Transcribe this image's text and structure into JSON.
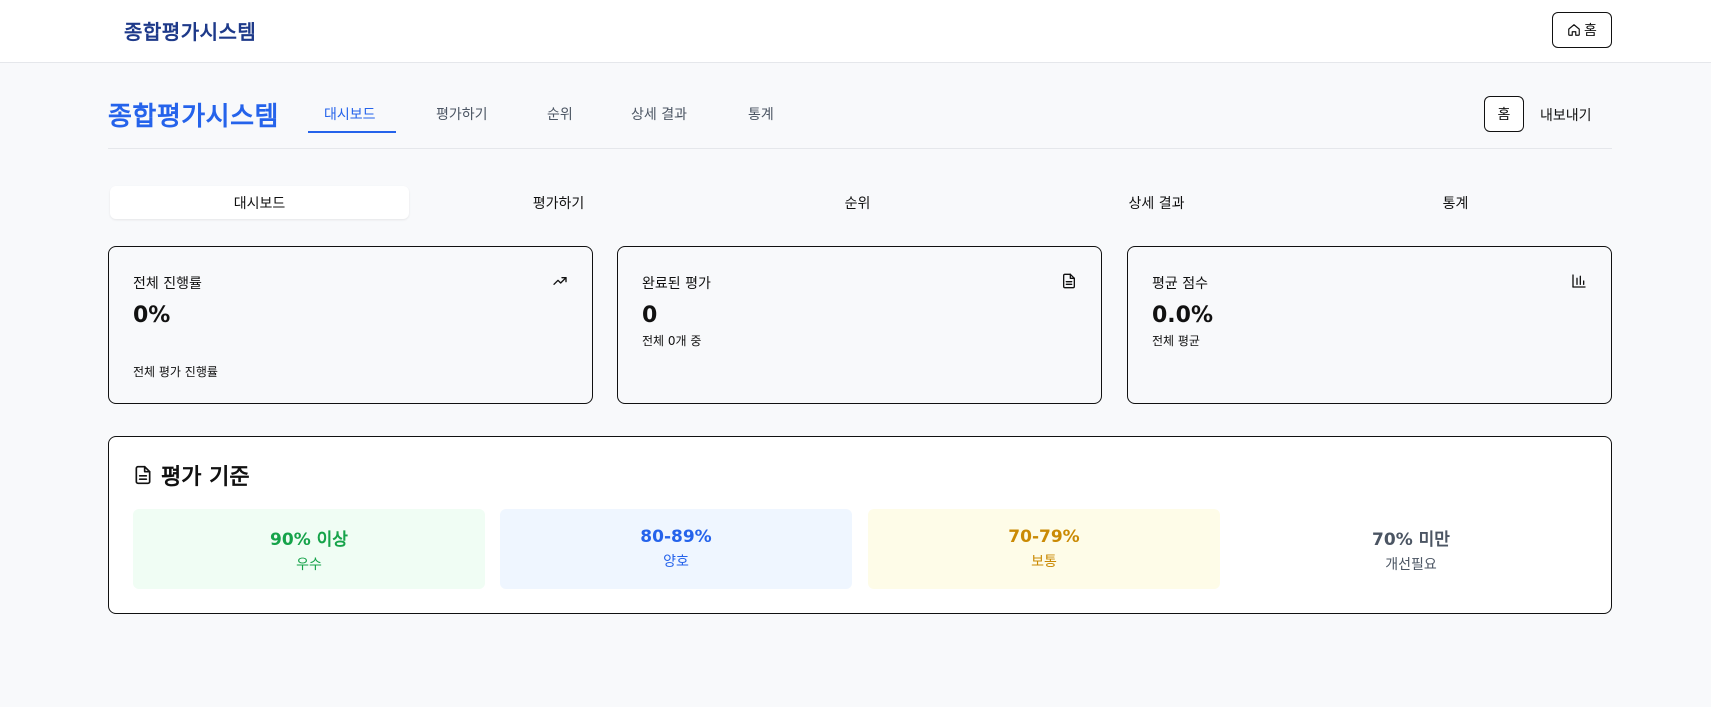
{
  "topbar": {
    "title": "종합평가시스템",
    "home_label": "홈"
  },
  "header": {
    "title": "종합평가시스템",
    "tabs": [
      {
        "label": "대시보드",
        "active": true
      },
      {
        "label": "평가하기",
        "active": false
      },
      {
        "label": "순위",
        "active": false
      },
      {
        "label": "상세 결과",
        "active": false
      },
      {
        "label": "통계",
        "active": false
      }
    ],
    "home_label": "홈",
    "export_label": "내보내기"
  },
  "subtabs": [
    {
      "label": "대시보드",
      "active": true
    },
    {
      "label": "평가하기",
      "active": false
    },
    {
      "label": "순위",
      "active": false
    },
    {
      "label": "상세 결과",
      "active": false
    },
    {
      "label": "통계",
      "active": false
    }
  ],
  "cards": [
    {
      "label": "전체 진행률",
      "value": "0%",
      "sub": "전체 평가 진행률",
      "icon": "trending-up-icon"
    },
    {
      "label": "완료된 평가",
      "value": "0",
      "sub": "전체 0개 중",
      "icon": "file-text-icon"
    },
    {
      "label": "평균 점수",
      "value": "0.0%",
      "sub": "전체 평균",
      "icon": "bar-chart-icon"
    }
  ],
  "criteria": {
    "title": "평가 기준",
    "icon": "file-text-icon",
    "levels": [
      {
        "range": "90% 이상",
        "label": "우수",
        "color": "#16a34a",
        "bg": "#f0fdf4"
      },
      {
        "range": "80-89%",
        "label": "양호",
        "color": "#2563eb",
        "bg": "#eff6ff"
      },
      {
        "range": "70-79%",
        "label": "보통",
        "color": "#ca8a04",
        "bg": "#fefce8"
      },
      {
        "range": "70% 미만",
        "label": "개선필요",
        "color": "#4b5563",
        "bg": "#ffffff"
      }
    ]
  }
}
